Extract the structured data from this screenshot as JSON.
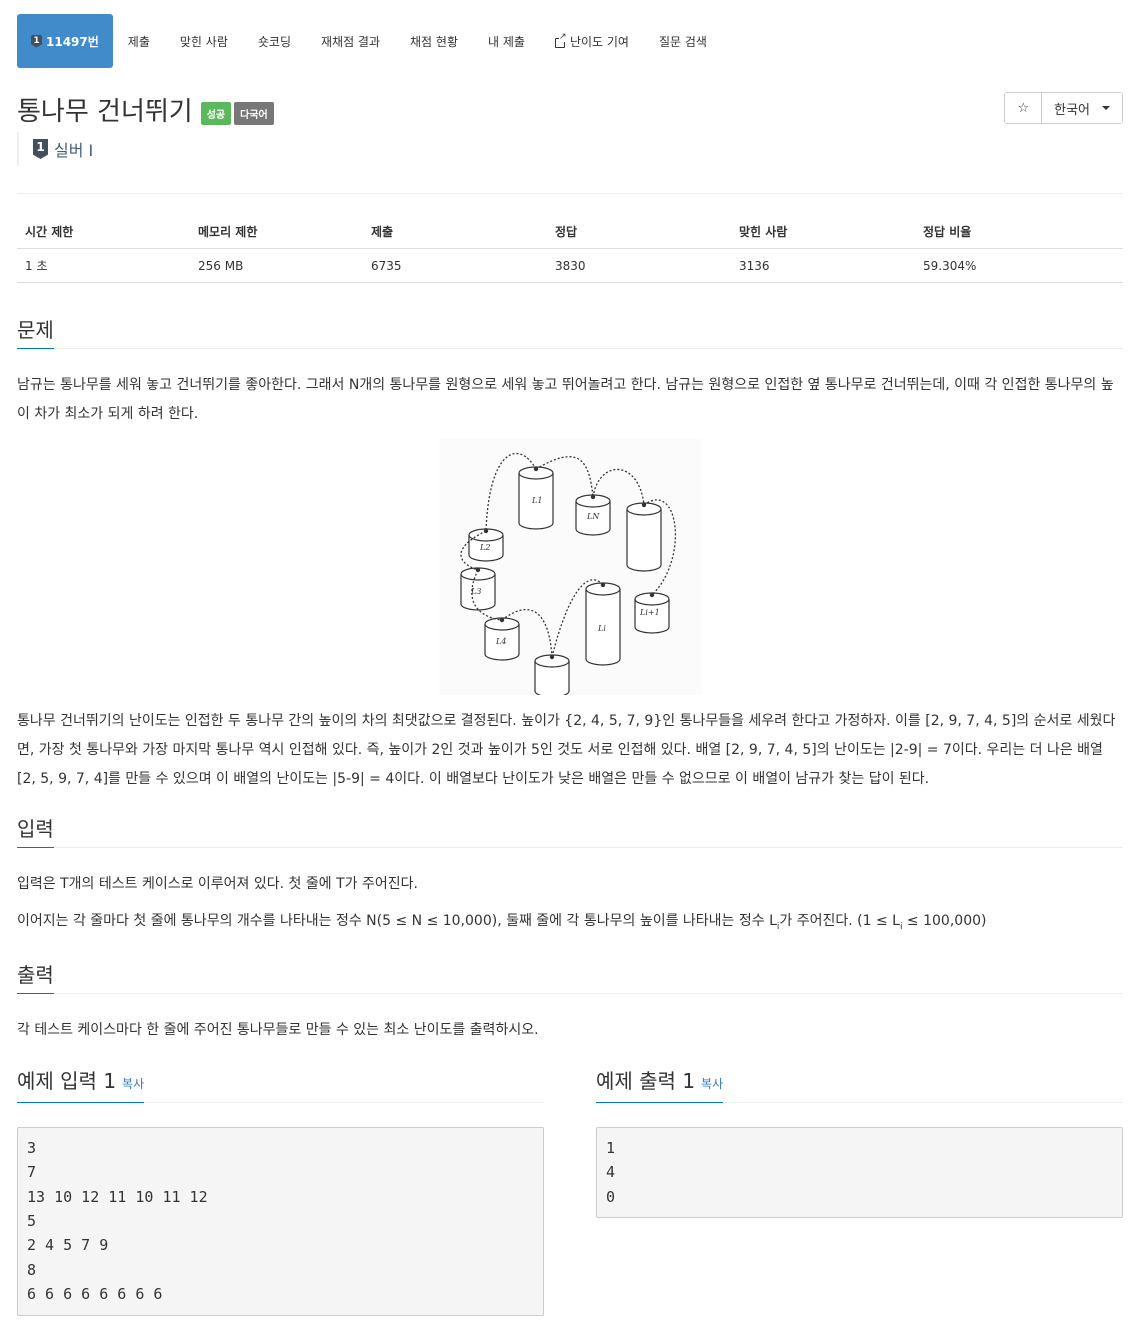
{
  "nav": {
    "problem_id": "11497번",
    "tier_num": "1",
    "items": [
      "제출",
      "맞힌 사람",
      "숏코딩",
      "재채점 결과",
      "채점 현황",
      "내 제출",
      "난이도 기여",
      "질문 검색"
    ]
  },
  "header": {
    "title": "통나무 건너뛰기",
    "labels": [
      "성공",
      "다국어"
    ],
    "star": "☆",
    "language": "한국어",
    "tier_badge": "1",
    "tier_text": "실버 I"
  },
  "stats": {
    "headers": [
      "시간 제한",
      "메모리 제한",
      "제출",
      "정답",
      "맞힌 사람",
      "정답 비율"
    ],
    "values": [
      "1 초",
      "256 MB",
      "6735",
      "3830",
      "3136",
      "59.304%"
    ]
  },
  "problem": {
    "heading": "문제",
    "para1": "남규는 통나무를 세워 놓고 건너뛰기를 좋아한다. 그래서 N개의 통나무를 원형으로 세워 놓고 뛰어놀려고 한다. 남규는 원형으로 인접한 옆 통나무로 건너뛰는데, 이때 각 인접한 통나무의 높이 차가 최소가 되게 하려 한다.",
    "para2": "통나무 건너뛰기의 난이도는 인접한 두 통나무 간의 높이의 차의 최댓값으로 결정된다. 높이가 {2, 4, 5, 7, 9}인 통나무들을 세우려 한다고 가정하자. 이를 [2, 9, 7, 4, 5]의 순서로 세웠다면, 가장 첫 통나무와 가장 마지막 통나무 역시 인접해 있다. 즉, 높이가 2인 것과 높이가 5인 것도 서로 인접해 있다. 배열 [2, 9, 7, 4, 5]의 난이도는 |2-9| = 7이다. 우리는 더 나은 배열 [2, 5, 9, 7, 4]를 만들 수 있으며 이 배열의 난이도는 |5-9| = 4이다. 이 배열보다 난이도가 낮은 배열은 만들 수 없으므로 이 배열이 남규가 찾는 답이 된다.",
    "figure_labels": [
      "L1",
      "LN",
      "L2",
      "L3",
      "L4",
      "Li",
      "Li+1"
    ]
  },
  "input": {
    "heading": "입력",
    "line1": "입력은 T개의 테스트 케이스로 이루어져 있다. 첫 줄에 T가 주어진다.",
    "line2_a": "이어지는 각 줄마다 첫 줄에 통나무의 개수를 나타내는 정수 N(5 ≤ N ≤ 10,000), 둘째 줄에 각 통나무의 높이를 나타내는 정수 L",
    "line2_sub": "i",
    "line2_b": "가 주어진다. (1 ≤ L",
    "line2_sub2": "i",
    "line2_c": " ≤ 100,000)"
  },
  "output": {
    "heading": "출력",
    "line1": "각 테스트 케이스마다 한 줄에 주어진 통나무들로 만들 수 있는 최소 난이도를 출력하시오."
  },
  "sample_input": {
    "heading": "예제 입력 1",
    "copy": "복사",
    "text": "3\n7\n13 10 12 11 10 11 12\n5\n2 4 5 7 9\n8\n6 6 6 6 6 6 6 6"
  },
  "sample_output": {
    "heading": "예제 출력 1",
    "copy": "복사",
    "text": "1\n4\n0"
  }
}
